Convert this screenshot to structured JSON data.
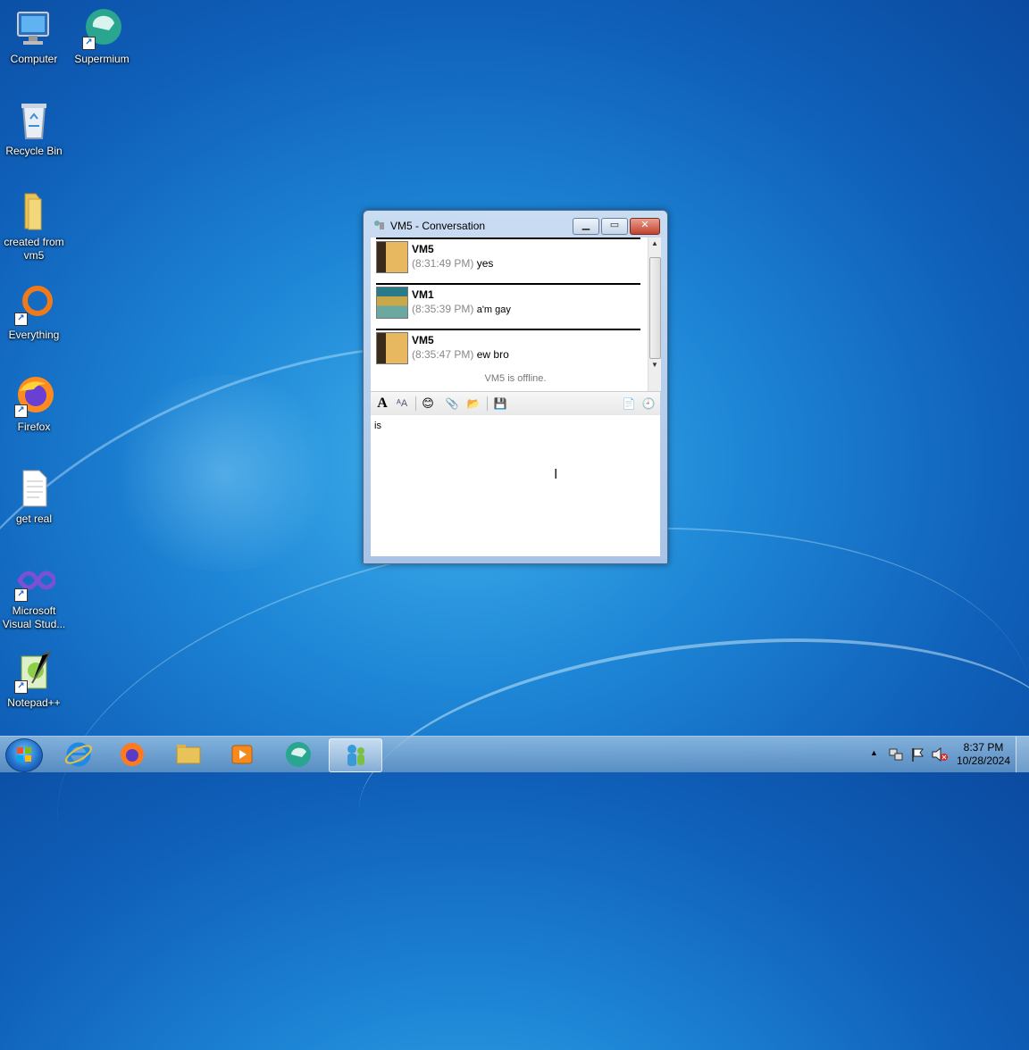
{
  "desktop": {
    "icons": [
      {
        "label": "Computer"
      },
      {
        "label": "Supermium"
      },
      {
        "label": "Recycle Bin"
      },
      {
        "label": "created from vm5"
      },
      {
        "label": "Everything"
      },
      {
        "label": "Firefox"
      },
      {
        "label": "get real"
      },
      {
        "label": "Microsoft Visual Stud..."
      },
      {
        "label": "Notepad++"
      }
    ]
  },
  "window": {
    "title": "VM5 - Conversation",
    "messages": [
      {
        "sender": "VM5",
        "time": "(8:31:49 PM)",
        "text": "yes"
      },
      {
        "sender": "VM1",
        "time": "(8:35:39 PM)",
        "text": "a'm gay"
      },
      {
        "sender": "VM5",
        "time": "(8:35:47 PM)",
        "text": "ew bro"
      }
    ],
    "status": "VM5 is offline.",
    "input_text": "is"
  },
  "taskbar": {
    "clock_time": "8:37 PM",
    "clock_date": "10/28/2024"
  }
}
